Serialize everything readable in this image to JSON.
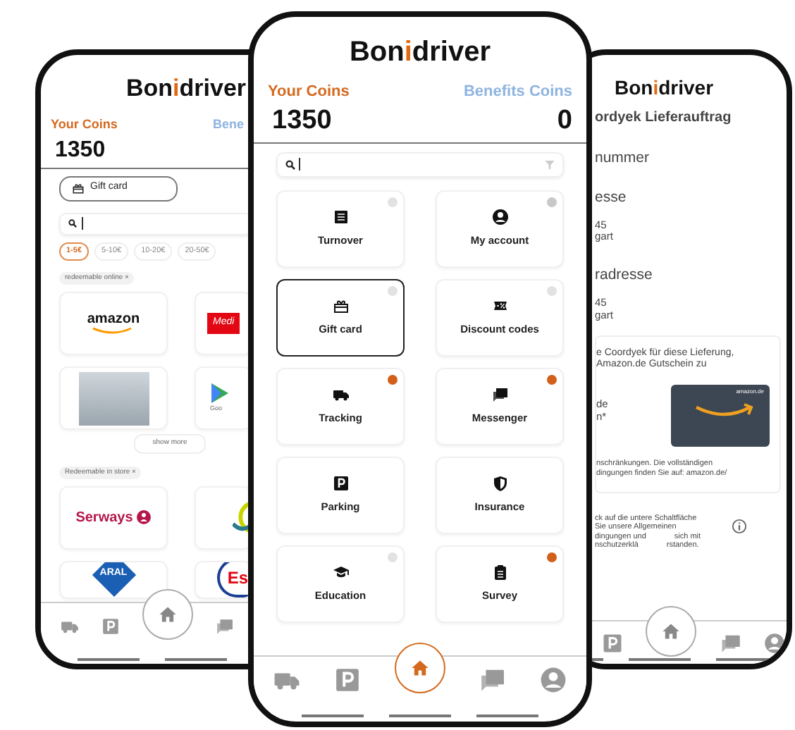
{
  "left_phone": {
    "logo": {
      "start": "Bon",
      "accent": "i",
      "end": "driver"
    },
    "your_coins": {
      "label": "Your Coins",
      "value": "1350"
    },
    "benefits_coins": {
      "label": "Bene"
    },
    "category_button": {
      "label": "Gift card"
    },
    "price_filters": [
      {
        "label": "1-5€",
        "selected": true
      },
      {
        "label": "5-10€",
        "selected": false
      },
      {
        "label": "10-20€",
        "selected": false
      },
      {
        "label": "20-50€",
        "selected": false
      }
    ],
    "sections": [
      {
        "tag": "redeemable online",
        "tag_close": "×",
        "brands": [
          {
            "kind": "amazon",
            "text": "amazon"
          },
          {
            "kind": "redbox",
            "text": "Medi"
          },
          {
            "kind": "photo"
          },
          {
            "kind": "play",
            "text": "Goo"
          }
        ],
        "show_more": "show more"
      },
      {
        "tag": "Redeemable in store",
        "tag_close": "×",
        "brands": [
          {
            "kind": "serways",
            "text": "Serways"
          },
          {
            "kind": "ring"
          },
          {
            "kind": "aral",
            "text": "ARAL"
          },
          {
            "kind": "esso",
            "text": "Es"
          }
        ]
      }
    ],
    "nav": [
      {
        "kind": "truck",
        "selected": false
      },
      {
        "kind": "parking",
        "selected": false
      },
      {
        "kind": "home",
        "selected": false
      },
      {
        "kind": "messages",
        "selected": false
      }
    ]
  },
  "main_phone": {
    "logo": {
      "start": "Bon",
      "accent": "i",
      "end": "driver"
    },
    "your_coins": {
      "label": "Your Coins",
      "value": "1350"
    },
    "benefits_coins": {
      "label": "Benefits Coins",
      "value": "0"
    },
    "tiles": [
      {
        "label": "Turnover",
        "kind": "list",
        "selected": false,
        "badge": {
          "color": "#e2e2e2"
        }
      },
      {
        "label": "My account",
        "kind": "account",
        "selected": false,
        "badge": {
          "color": "#c8c8c8"
        }
      },
      {
        "label": "Gift card",
        "kind": "gift",
        "selected": true,
        "badge": {
          "color": "#e2e2e2"
        }
      },
      {
        "label": "Discount codes",
        "kind": "percent",
        "selected": false,
        "badge": {
          "color": "#e2e2e2"
        }
      },
      {
        "label": "Tracking",
        "kind": "truck",
        "selected": false,
        "badge": {
          "color": "#d2601a"
        }
      },
      {
        "label": "Messenger",
        "kind": "messages",
        "selected": false,
        "badge": {
          "color": "#d2601a"
        }
      },
      {
        "label": "Parking",
        "kind": "parking",
        "selected": false
      },
      {
        "label": "Insurance",
        "kind": "shield",
        "selected": false
      },
      {
        "label": "Education",
        "kind": "cap",
        "selected": false,
        "badge": {
          "color": "#e2e2e2"
        }
      },
      {
        "label": "Survey",
        "kind": "clipboard",
        "selected": false,
        "badge": {
          "color": "#d2601a"
        }
      }
    ],
    "nav": [
      {
        "kind": "truck",
        "selected": false
      },
      {
        "kind": "parking",
        "selected": false
      },
      {
        "kind": "home",
        "selected": true
      },
      {
        "kind": "messages",
        "selected": false
      },
      {
        "kind": "account",
        "selected": false
      }
    ]
  },
  "detail_phone": {
    "logo": {
      "start": "Bon",
      "accent": "i",
      "end": "driver"
    },
    "lines": [
      {
        "kind": "heading",
        "text": "ordyek Lieferauftrag"
      },
      {
        "kind": "label",
        "text": "nummer"
      },
      {
        "kind": "label",
        "text": "esse"
      },
      {
        "kind": "value",
        "text": "45"
      },
      {
        "kind": "value",
        "text": "gart"
      },
      {
        "kind": "label",
        "text": "radresse"
      },
      {
        "kind": "value",
        "text": "45"
      },
      {
        "kind": "value",
        "text": "gart"
      }
    ],
    "voucher_card": {
      "lines": [
        "e Coordyek für diese Lieferung,",
        "Amazon.de Gutschein zu"
      ],
      "side_lines": [
        "de",
        "n*"
      ],
      "gift_card_text": "amazon.de",
      "fine_print": [
        "nschränkungen. Die vollständigen",
        "dingungen finden Sie auf: amazon.de/"
      ]
    },
    "terms": [
      {
        "left": "ck auf die untere Schaltfläche"
      },
      {
        "left": "Sie unsere Allgemeinen"
      },
      {
        "left": "dingungen und",
        "right": "sich mit"
      },
      {
        "left": "nschutzerklä",
        "right": "rstanden."
      }
    ],
    "nav": [
      {
        "kind": "parking",
        "selected": false
      },
      {
        "kind": "home",
        "selected": false
      },
      {
        "kind": "messages",
        "selected": false
      },
      {
        "kind": "account",
        "selected": false
      }
    ]
  }
}
